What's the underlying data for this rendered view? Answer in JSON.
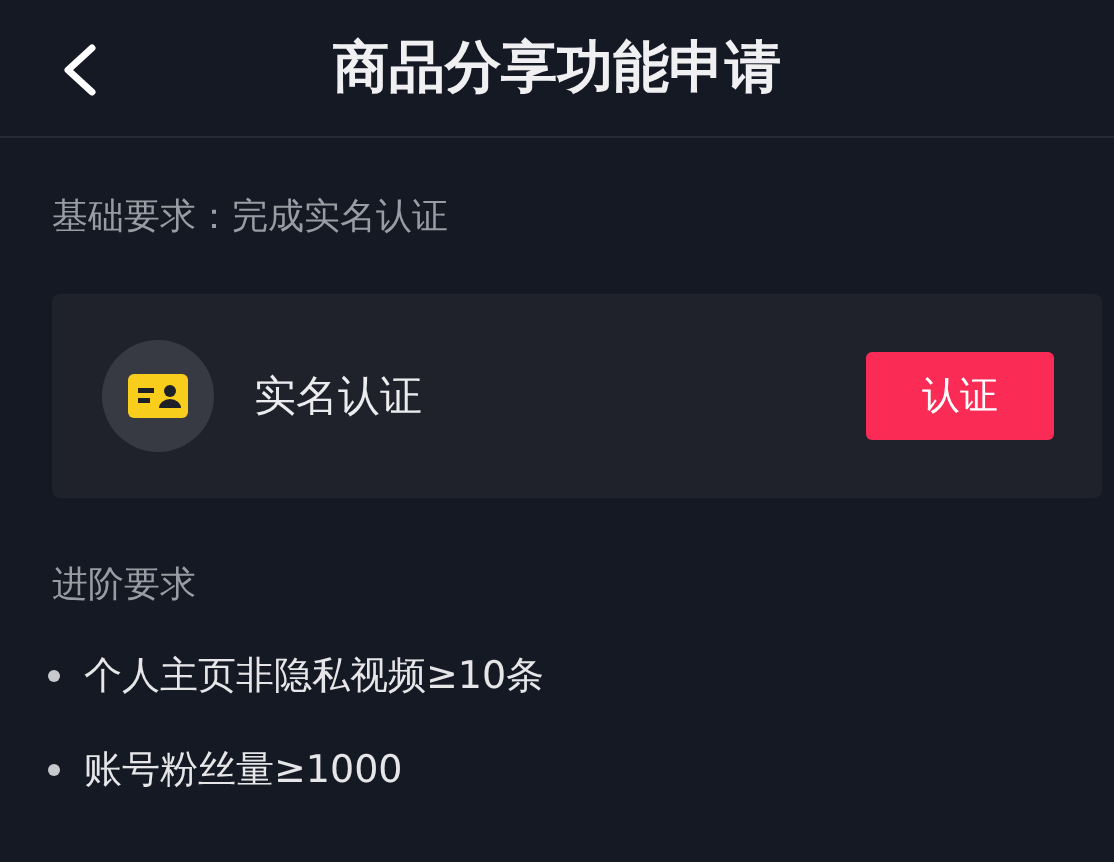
{
  "header": {
    "title": "商品分享功能申请"
  },
  "basic_requirement": "基础要求：完成实名认证",
  "verification_card": {
    "title": "实名认证",
    "button": "认证"
  },
  "advanced_section": {
    "heading": "进阶要求",
    "items": [
      "个人主页非隐私视频≥10条",
      "账号粉丝量≥1000"
    ]
  }
}
